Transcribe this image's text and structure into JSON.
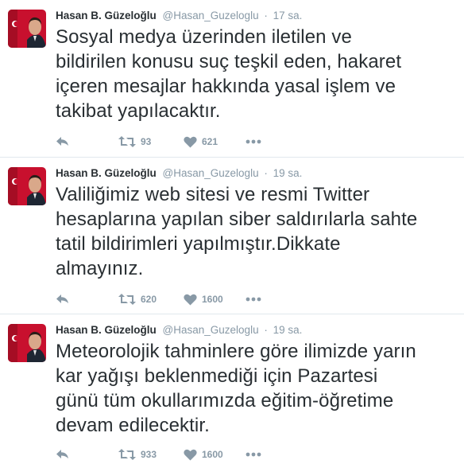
{
  "colors": {
    "text": "#292f33",
    "muted": "#8899a6",
    "divider": "#e1e8ed"
  },
  "icons": {
    "reply": "reply-arrow-icon",
    "retweet": "retweet-icon",
    "like": "heart-icon",
    "more": "more-dots-icon"
  },
  "tweets": [
    {
      "author": {
        "name": "Hasan B. Güzeloğlu",
        "handle": "@Hasan_Guzeloglu"
      },
      "separator": "·",
      "time": "17 sa.",
      "lines": [
        "Sosyal medya üzerinden iletilen ve",
        "bildirilen konusu suç teşkil eden, hakaret",
        "içeren mesajlar hakkında yasal işlem ve",
        "takibat yapılacaktır."
      ],
      "retweets": "93",
      "likes": "621"
    },
    {
      "author": {
        "name": "Hasan B. Güzeloğlu",
        "handle": "@Hasan_Guzeloglu"
      },
      "separator": "·",
      "time": "19 sa.",
      "lines": [
        "Valiliğimiz web sitesi ve resmi Twitter",
        "hesaplarına yapılan siber saldırılarla sahte",
        "tatil bildirimleri yapılmıştır.Dikkate",
        "almayınız."
      ],
      "retweets": "620",
      "likes": "1600"
    },
    {
      "author": {
        "name": "Hasan B. Güzeloğlu",
        "handle": "@Hasan_Guzeloglu"
      },
      "separator": "·",
      "time": "19 sa.",
      "lines": [
        "Meteorolojik tahminlere göre ilimizde yarın",
        "kar yağışı beklenmediği için Pazartesi",
        "günü tüm okullarımızda eğitim-öğretime",
        "devam edilecektir."
      ],
      "retweets": "933",
      "likes": "1600"
    }
  ]
}
